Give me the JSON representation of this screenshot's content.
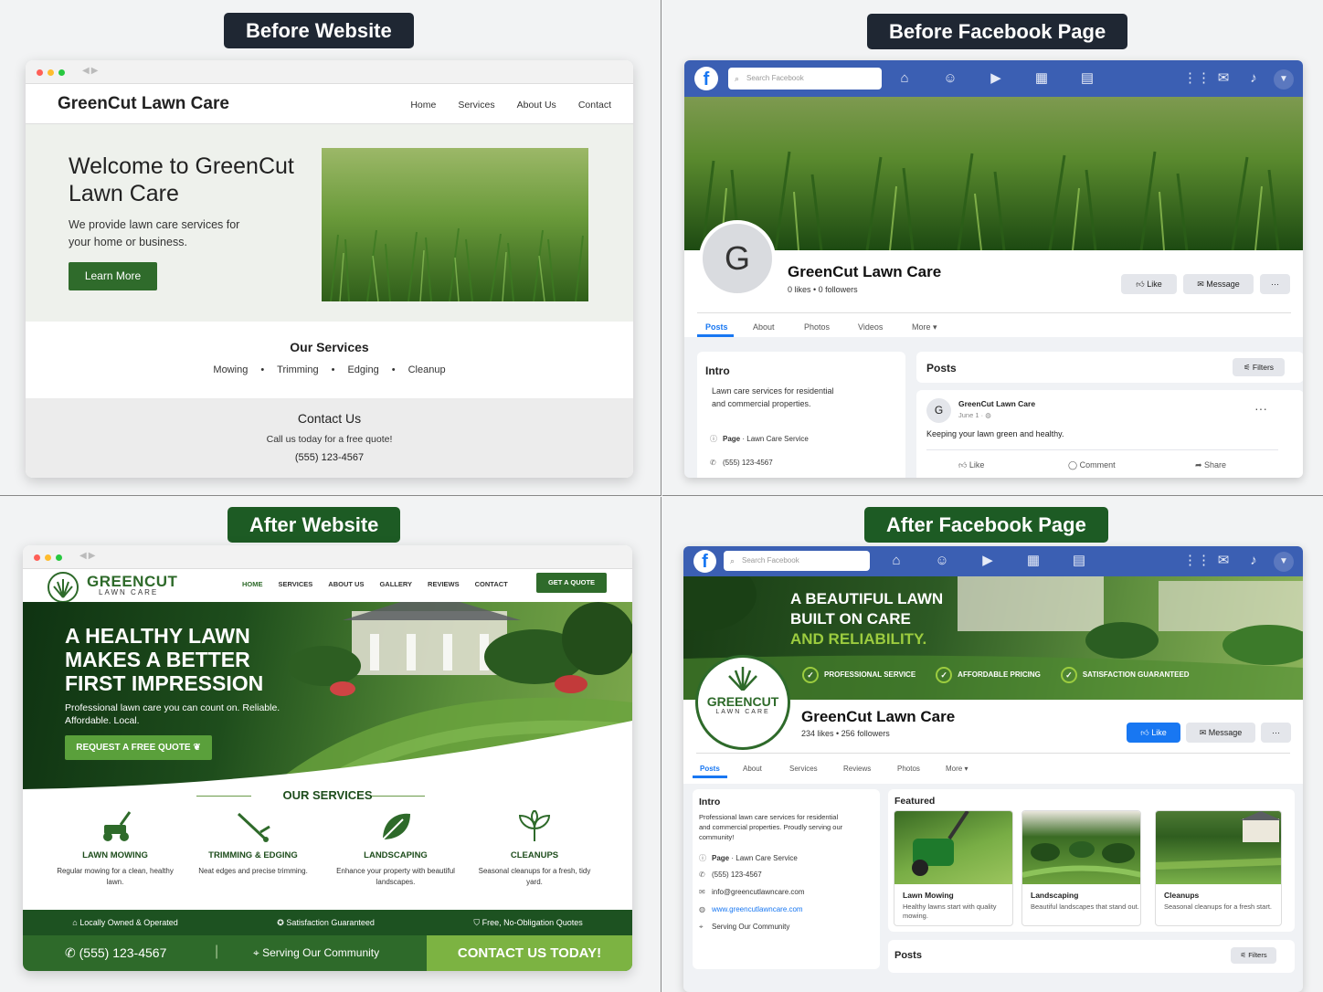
{
  "labels": {
    "before_website": "Before Website",
    "before_facebook": "Before Facebook Page",
    "after_website": "After Website",
    "after_facebook": "After Facebook Page"
  },
  "before_website": {
    "brand": "GreenCut Lawn Care",
    "nav": [
      "Home",
      "Services",
      "About Us",
      "Contact"
    ],
    "hero_title": "Welcome to GreenCut Lawn Care",
    "hero_text": "We provide lawn care services for your home or business.",
    "hero_button": "Learn More",
    "services_title": "Our Services",
    "services": [
      "Mowing",
      "Trimming",
      "Edging",
      "Cleanup"
    ],
    "contact_title": "Contact Us",
    "contact_text": "Call us today for a free quote!",
    "phone": "(555) 123-4567"
  },
  "before_facebook": {
    "search_placeholder": "Search Facebook",
    "avatar_letter": "G",
    "page_name": "GreenCut Lawn Care",
    "stats": "0 likes • 0 followers",
    "buttons": {
      "like": "Like",
      "message": "Message",
      "more": "···"
    },
    "tabs": [
      "Posts",
      "About",
      "Photos",
      "Videos",
      "More ▾"
    ],
    "intro_title": "Intro",
    "intro_text": "Lawn care services for residential and commercial properties.",
    "intro_page": "Page",
    "intro_category": "· Lawn Care Service",
    "intro_phone": "(555) 123-4567",
    "posts_title": "Posts",
    "filters": "Filters",
    "post": {
      "author": "GreenCut Lawn Care",
      "date": "June 1 · ",
      "avatar": "G",
      "text": "Keeping your lawn green and healthy.",
      "actions": [
        "Like",
        "Comment",
        "Share"
      ]
    }
  },
  "after_website": {
    "brand_main": "GREENCUT",
    "brand_sub": "LAWN CARE",
    "nav": [
      "HOME",
      "SERVICES",
      "ABOUT US",
      "GALLERY",
      "REVIEWS",
      "CONTACT"
    ],
    "quote_button": "GET A QUOTE",
    "hero_title": "A HEALTHY LAWN MAKES A BETTER FIRST IMPRESSION",
    "hero_text": "Professional lawn care you can count on. Reliable. Affordable. Local.",
    "hero_button": "REQUEST A FREE QUOTE",
    "services_title": "OUR SERVICES",
    "services": [
      {
        "title": "LAWN MOWING",
        "desc": "Regular mowing for a clean, healthy lawn.",
        "icon": "mower-icon"
      },
      {
        "title": "TRIMMING & EDGING",
        "desc": "Neat edges and precise trimming.",
        "icon": "trimmer-icon"
      },
      {
        "title": "LANDSCAPING",
        "desc": "Enhance your property with beautiful landscapes.",
        "icon": "leaf-icon"
      },
      {
        "title": "CLEANUPS",
        "desc": "Seasonal cleanups for a fresh, tidy yard.",
        "icon": "plant-icon"
      }
    ],
    "trust": [
      "Locally Owned & Operated",
      "Satisfaction Guaranteed",
      "Free, No-Obligation Quotes"
    ],
    "phone": "(555) 123-4567",
    "service_area": "Serving Our Community",
    "cta": "CONTACT US TODAY!"
  },
  "after_facebook": {
    "search_placeholder": "Search Facebook",
    "cover_line1": "A BEAUTIFUL LAWN",
    "cover_line2": "BUILT ON CARE",
    "cover_line3": "AND RELIABILITY.",
    "badges": [
      "PROFESSIONAL SERVICE",
      "AFFORDABLE PRICING",
      "SATISFACTION GUARANTEED"
    ],
    "logo_main": "GREENCUT",
    "logo_sub": "LAWN CARE",
    "page_name": "GreenCut Lawn Care",
    "stats": "234 likes • 256 followers",
    "buttons": {
      "like": "Like",
      "message": "Message",
      "more": "···"
    },
    "tabs": [
      "Posts",
      "About",
      "Services",
      "Reviews",
      "Photos",
      "More ▾"
    ],
    "intro_title": "Intro",
    "intro_text": "Professional lawn care services for residential and commercial properties. Proudly serving our community!",
    "intro_page": "Page",
    "intro_category": "· Lawn Care Service",
    "intro_phone": "(555) 123-4567",
    "intro_email": "info@greencutlawncare.com",
    "intro_site": "www.greencutlawncare.com",
    "intro_area": "Serving Our Community",
    "featured_title": "Featured",
    "featured": [
      {
        "title": "Lawn Mowing",
        "desc": "Healthy lawns start with quality mowing."
      },
      {
        "title": "Landscaping",
        "desc": "Beautiful landscapes that stand out."
      },
      {
        "title": "Cleanups",
        "desc": "Seasonal cleanups for a fresh start."
      }
    ],
    "posts_title": "Posts",
    "filters": "Filters"
  },
  "colors": {
    "fb_blue": "#3b5fb3",
    "brand_green": "#2e6a2a",
    "accent_green": "#7cb342",
    "label_dark": "#1f2733"
  }
}
